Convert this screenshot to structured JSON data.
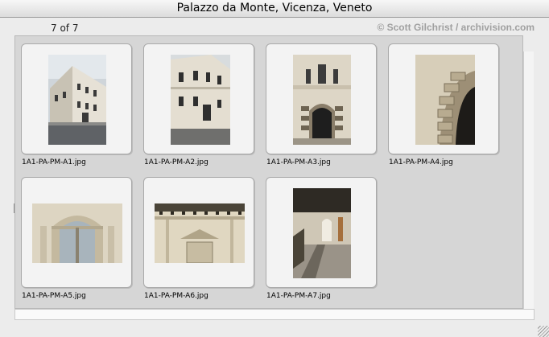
{
  "window": {
    "title": "Palazzo da Monte, Vicenza, Veneto"
  },
  "header": {
    "counter": "7 of 7",
    "copyright": "© Scott Gilchrist / archivision.com"
  },
  "thumbnails": [
    {
      "filename": "1A1-PA-PM-A1.jpg",
      "icon": "palazzo-corner-view-photo"
    },
    {
      "filename": "1A1-PA-PM-A2.jpg",
      "icon": "palazzo-facade-photo"
    },
    {
      "filename": "1A1-PA-PM-A3.jpg",
      "icon": "palazzo-portal-photo"
    },
    {
      "filename": "1A1-PA-PM-A4.jpg",
      "icon": "rusticated-arch-photo"
    },
    {
      "filename": "1A1-PA-PM-A5.jpg",
      "icon": "arched-window-photo"
    },
    {
      "filename": "1A1-PA-PM-A6.jpg",
      "icon": "cornice-window-photo"
    },
    {
      "filename": "1A1-PA-PM-A7.jpg",
      "icon": "courtyard-passage-photo"
    }
  ]
}
